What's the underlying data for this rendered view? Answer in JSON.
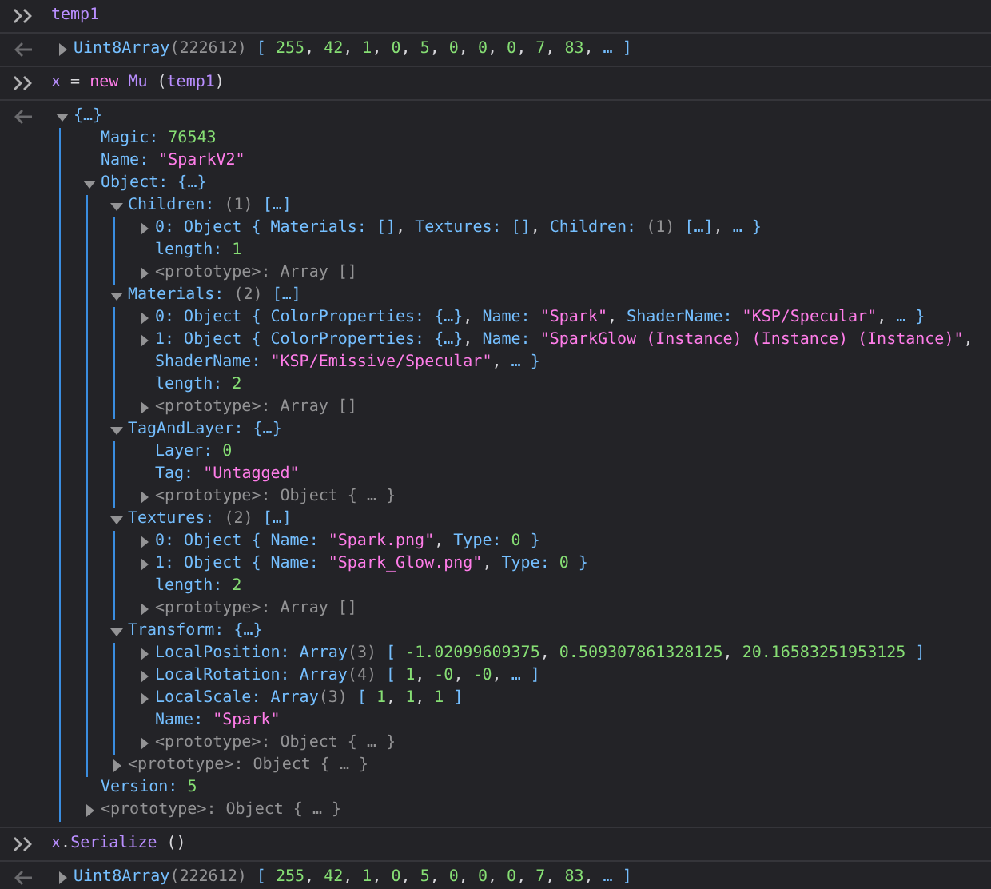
{
  "console": [
    {
      "kind": "input",
      "tokens": [
        {
          "kind": "ident",
          "text": "temp1"
        }
      ]
    },
    {
      "kind": "output",
      "nodes": [
        {
          "kind": "node",
          "expanded": false,
          "tokens": [
            {
              "kind": "key",
              "text": "Uint8Array"
            },
            {
              "kind": "dim",
              "text": "(222612) "
            },
            {
              "kind": "brace",
              "text": "[ "
            },
            {
              "kind": "num",
              "text": "255"
            },
            {
              "kind": "text",
              "text": ", "
            },
            {
              "kind": "num",
              "text": "42"
            },
            {
              "kind": "text",
              "text": ", "
            },
            {
              "kind": "num",
              "text": "1"
            },
            {
              "kind": "text",
              "text": ", "
            },
            {
              "kind": "num",
              "text": "0"
            },
            {
              "kind": "text",
              "text": ", "
            },
            {
              "kind": "num",
              "text": "5"
            },
            {
              "kind": "text",
              "text": ", "
            },
            {
              "kind": "num",
              "text": "0"
            },
            {
              "kind": "text",
              "text": ", "
            },
            {
              "kind": "num",
              "text": "0"
            },
            {
              "kind": "text",
              "text": ", "
            },
            {
              "kind": "num",
              "text": "0"
            },
            {
              "kind": "text",
              "text": ", "
            },
            {
              "kind": "num",
              "text": "7"
            },
            {
              "kind": "text",
              "text": ", "
            },
            {
              "kind": "num",
              "text": "83"
            },
            {
              "kind": "text",
              "text": ", "
            },
            {
              "kind": "brace",
              "text": "… ]"
            }
          ]
        }
      ]
    },
    {
      "kind": "input",
      "tokens": [
        {
          "kind": "ident",
          "text": "x"
        },
        {
          "kind": "op",
          "text": " = "
        },
        {
          "kind": "keyword",
          "text": "new "
        },
        {
          "kind": "ident",
          "text": "Mu"
        },
        {
          "kind": "op",
          "text": " ("
        },
        {
          "kind": "ident",
          "text": "temp1"
        },
        {
          "kind": "op",
          "text": ")"
        }
      ]
    },
    {
      "kind": "output",
      "nodes": [
        {
          "kind": "node",
          "expanded": true,
          "tokens": [
            {
              "kind": "brace",
              "text": "{…}"
            }
          ],
          "children": [
            {
              "kind": "leaf",
              "tokens": [
                {
                  "kind": "key",
                  "text": "Magic: "
                },
                {
                  "kind": "num",
                  "text": "76543"
                }
              ]
            },
            {
              "kind": "leaf",
              "tokens": [
                {
                  "kind": "key",
                  "text": "Name: "
                },
                {
                  "kind": "str",
                  "text": "\"SparkV2\""
                }
              ]
            },
            {
              "kind": "node",
              "expanded": true,
              "tokens": [
                {
                  "kind": "key",
                  "text": "Object: "
                },
                {
                  "kind": "brace",
                  "text": "{…}"
                }
              ],
              "children": [
                {
                  "kind": "node",
                  "expanded": true,
                  "tokens": [
                    {
                      "kind": "key",
                      "text": "Children: "
                    },
                    {
                      "kind": "dim",
                      "text": "(1) "
                    },
                    {
                      "kind": "brace",
                      "text": "[…]"
                    }
                  ],
                  "children": [
                    {
                      "kind": "node",
                      "expanded": false,
                      "tokens": [
                        {
                          "kind": "key",
                          "text": "0: Object { "
                        },
                        {
                          "kind": "key",
                          "text": "Materials: "
                        },
                        {
                          "kind": "brace",
                          "text": "[]"
                        },
                        {
                          "kind": "text",
                          "text": ", "
                        },
                        {
                          "kind": "key",
                          "text": "Textures: "
                        },
                        {
                          "kind": "brace",
                          "text": "[]"
                        },
                        {
                          "kind": "text",
                          "text": ", "
                        },
                        {
                          "kind": "key",
                          "text": "Children: "
                        },
                        {
                          "kind": "dim",
                          "text": "(1) "
                        },
                        {
                          "kind": "brace",
                          "text": "[…]"
                        },
                        {
                          "kind": "text",
                          "text": ", "
                        },
                        {
                          "kind": "brace",
                          "text": "… }"
                        }
                      ]
                    },
                    {
                      "kind": "leaf",
                      "tokens": [
                        {
                          "kind": "key",
                          "text": "length: "
                        },
                        {
                          "kind": "num",
                          "text": "1"
                        }
                      ]
                    },
                    {
                      "kind": "node",
                      "expanded": false,
                      "tokens": [
                        {
                          "kind": "dim",
                          "text": "<prototype>: Array []"
                        }
                      ]
                    }
                  ]
                },
                {
                  "kind": "node",
                  "expanded": true,
                  "tokens": [
                    {
                      "kind": "key",
                      "text": "Materials: "
                    },
                    {
                      "kind": "dim",
                      "text": "(2) "
                    },
                    {
                      "kind": "brace",
                      "text": "[…]"
                    }
                  ],
                  "children": [
                    {
                      "kind": "node",
                      "expanded": false,
                      "tokens": [
                        {
                          "kind": "key",
                          "text": "0: Object { "
                        },
                        {
                          "kind": "key",
                          "text": "ColorProperties: "
                        },
                        {
                          "kind": "brace",
                          "text": "{…}"
                        },
                        {
                          "kind": "text",
                          "text": ", "
                        },
                        {
                          "kind": "key",
                          "text": "Name: "
                        },
                        {
                          "kind": "str",
                          "text": "\"Spark\""
                        },
                        {
                          "kind": "text",
                          "text": ", "
                        },
                        {
                          "kind": "key",
                          "text": "ShaderName: "
                        },
                        {
                          "kind": "str",
                          "text": "\"KSP/Specular\""
                        },
                        {
                          "kind": "text",
                          "text": ", "
                        },
                        {
                          "kind": "brace",
                          "text": "… }"
                        }
                      ]
                    },
                    {
                      "kind": "node",
                      "expanded": false,
                      "tokens": [
                        {
                          "kind": "key",
                          "text": "1: Object { "
                        },
                        {
                          "kind": "key",
                          "text": "ColorProperties: "
                        },
                        {
                          "kind": "brace",
                          "text": "{…}"
                        },
                        {
                          "kind": "text",
                          "text": ", "
                        },
                        {
                          "kind": "key",
                          "text": "Name: "
                        },
                        {
                          "kind": "str",
                          "text": "\"SparkGlow (Instance) (Instance) (Instance)\""
                        },
                        {
                          "kind": "text",
                          "text": ", "
                        },
                        {
                          "kind": "key",
                          "text": "ShaderName: "
                        },
                        {
                          "kind": "str",
                          "text": "\"KSP/Emissive/Specular\""
                        },
                        {
                          "kind": "text",
                          "text": ", "
                        },
                        {
                          "kind": "brace",
                          "text": "… }"
                        }
                      ]
                    },
                    {
                      "kind": "leaf",
                      "tokens": [
                        {
                          "kind": "key",
                          "text": "length: "
                        },
                        {
                          "kind": "num",
                          "text": "2"
                        }
                      ]
                    },
                    {
                      "kind": "node",
                      "expanded": false,
                      "tokens": [
                        {
                          "kind": "dim",
                          "text": "<prototype>: Array []"
                        }
                      ]
                    }
                  ]
                },
                {
                  "kind": "node",
                  "expanded": true,
                  "tokens": [
                    {
                      "kind": "key",
                      "text": "TagAndLayer: "
                    },
                    {
                      "kind": "brace",
                      "text": "{…}"
                    }
                  ],
                  "children": [
                    {
                      "kind": "leaf",
                      "tokens": [
                        {
                          "kind": "key",
                          "text": "Layer: "
                        },
                        {
                          "kind": "num",
                          "text": "0"
                        }
                      ]
                    },
                    {
                      "kind": "leaf",
                      "tokens": [
                        {
                          "kind": "key",
                          "text": "Tag: "
                        },
                        {
                          "kind": "str",
                          "text": "\"Untagged\""
                        }
                      ]
                    },
                    {
                      "kind": "node",
                      "expanded": false,
                      "tokens": [
                        {
                          "kind": "dim",
                          "text": "<prototype>: Object { … }"
                        }
                      ]
                    }
                  ]
                },
                {
                  "kind": "node",
                  "expanded": true,
                  "tokens": [
                    {
                      "kind": "key",
                      "text": "Textures: "
                    },
                    {
                      "kind": "dim",
                      "text": "(2) "
                    },
                    {
                      "kind": "brace",
                      "text": "[…]"
                    }
                  ],
                  "children": [
                    {
                      "kind": "node",
                      "expanded": false,
                      "tokens": [
                        {
                          "kind": "key",
                          "text": "0: Object { "
                        },
                        {
                          "kind": "key",
                          "text": "Name: "
                        },
                        {
                          "kind": "str",
                          "text": "\"Spark.png\""
                        },
                        {
                          "kind": "text",
                          "text": ", "
                        },
                        {
                          "kind": "key",
                          "text": "Type: "
                        },
                        {
                          "kind": "num",
                          "text": "0"
                        },
                        {
                          "kind": "brace",
                          "text": " }"
                        }
                      ]
                    },
                    {
                      "kind": "node",
                      "expanded": false,
                      "tokens": [
                        {
                          "kind": "key",
                          "text": "1: Object { "
                        },
                        {
                          "kind": "key",
                          "text": "Name: "
                        },
                        {
                          "kind": "str",
                          "text": "\"Spark_Glow.png\""
                        },
                        {
                          "kind": "text",
                          "text": ", "
                        },
                        {
                          "kind": "key",
                          "text": "Type: "
                        },
                        {
                          "kind": "num",
                          "text": "0"
                        },
                        {
                          "kind": "brace",
                          "text": " }"
                        }
                      ]
                    },
                    {
                      "kind": "leaf",
                      "tokens": [
                        {
                          "kind": "key",
                          "text": "length: "
                        },
                        {
                          "kind": "num",
                          "text": "2"
                        }
                      ]
                    },
                    {
                      "kind": "node",
                      "expanded": false,
                      "tokens": [
                        {
                          "kind": "dim",
                          "text": "<prototype>: Array []"
                        }
                      ]
                    }
                  ]
                },
                {
                  "kind": "node",
                  "expanded": true,
                  "tokens": [
                    {
                      "kind": "key",
                      "text": "Transform: "
                    },
                    {
                      "kind": "brace",
                      "text": "{…}"
                    }
                  ],
                  "children": [
                    {
                      "kind": "node",
                      "expanded": false,
                      "tokens": [
                        {
                          "kind": "key",
                          "text": "LocalPosition: "
                        },
                        {
                          "kind": "key",
                          "text": "Array"
                        },
                        {
                          "kind": "dim",
                          "text": "(3) "
                        },
                        {
                          "kind": "brace",
                          "text": "[ "
                        },
                        {
                          "kind": "num",
                          "text": "-1.02099609375"
                        },
                        {
                          "kind": "text",
                          "text": ", "
                        },
                        {
                          "kind": "num",
                          "text": "0.509307861328125"
                        },
                        {
                          "kind": "text",
                          "text": ", "
                        },
                        {
                          "kind": "num",
                          "text": "20.16583251953125"
                        },
                        {
                          "kind": "brace",
                          "text": " ]"
                        }
                      ]
                    },
                    {
                      "kind": "node",
                      "expanded": false,
                      "tokens": [
                        {
                          "kind": "key",
                          "text": "LocalRotation: "
                        },
                        {
                          "kind": "key",
                          "text": "Array"
                        },
                        {
                          "kind": "dim",
                          "text": "(4) "
                        },
                        {
                          "kind": "brace",
                          "text": "[ "
                        },
                        {
                          "kind": "num",
                          "text": "1"
                        },
                        {
                          "kind": "text",
                          "text": ", "
                        },
                        {
                          "kind": "num",
                          "text": "-0"
                        },
                        {
                          "kind": "text",
                          "text": ", "
                        },
                        {
                          "kind": "num",
                          "text": "-0"
                        },
                        {
                          "kind": "text",
                          "text": ", "
                        },
                        {
                          "kind": "brace",
                          "text": "… ]"
                        }
                      ]
                    },
                    {
                      "kind": "node",
                      "expanded": false,
                      "tokens": [
                        {
                          "kind": "key",
                          "text": "LocalScale: "
                        },
                        {
                          "kind": "key",
                          "text": "Array"
                        },
                        {
                          "kind": "dim",
                          "text": "(3) "
                        },
                        {
                          "kind": "brace",
                          "text": "[ "
                        },
                        {
                          "kind": "num",
                          "text": "1"
                        },
                        {
                          "kind": "text",
                          "text": ", "
                        },
                        {
                          "kind": "num",
                          "text": "1"
                        },
                        {
                          "kind": "text",
                          "text": ", "
                        },
                        {
                          "kind": "num",
                          "text": "1"
                        },
                        {
                          "kind": "brace",
                          "text": " ]"
                        }
                      ]
                    },
                    {
                      "kind": "leaf",
                      "tokens": [
                        {
                          "kind": "key",
                          "text": "Name: "
                        },
                        {
                          "kind": "str",
                          "text": "\"Spark\""
                        }
                      ]
                    },
                    {
                      "kind": "node",
                      "expanded": false,
                      "tokens": [
                        {
                          "kind": "dim",
                          "text": "<prototype>: Object { … }"
                        }
                      ]
                    }
                  ]
                },
                {
                  "kind": "node",
                  "expanded": false,
                  "tokens": [
                    {
                      "kind": "dim",
                      "text": "<prototype>: Object { … }"
                    }
                  ]
                }
              ]
            },
            {
              "kind": "leaf",
              "tokens": [
                {
                  "kind": "key",
                  "text": "Version: "
                },
                {
                  "kind": "num",
                  "text": "5"
                }
              ]
            },
            {
              "kind": "node",
              "expanded": false,
              "tokens": [
                {
                  "kind": "dim",
                  "text": "<prototype>: Object { … }"
                }
              ]
            }
          ]
        }
      ]
    },
    {
      "kind": "input",
      "tokens": [
        {
          "kind": "ident",
          "text": "x"
        },
        {
          "kind": "op",
          "text": "."
        },
        {
          "kind": "ident",
          "text": "Serialize"
        },
        {
          "kind": "op",
          "text": " ()"
        }
      ]
    },
    {
      "kind": "output",
      "nodes": [
        {
          "kind": "node",
          "expanded": false,
          "tokens": [
            {
              "kind": "key",
              "text": "Uint8Array"
            },
            {
              "kind": "dim",
              "text": "(222612) "
            },
            {
              "kind": "brace",
              "text": "[ "
            },
            {
              "kind": "num",
              "text": "255"
            },
            {
              "kind": "text",
              "text": ", "
            },
            {
              "kind": "num",
              "text": "42"
            },
            {
              "kind": "text",
              "text": ", "
            },
            {
              "kind": "num",
              "text": "1"
            },
            {
              "kind": "text",
              "text": ", "
            },
            {
              "kind": "num",
              "text": "0"
            },
            {
              "kind": "text",
              "text": ", "
            },
            {
              "kind": "num",
              "text": "5"
            },
            {
              "kind": "text",
              "text": ", "
            },
            {
              "kind": "num",
              "text": "0"
            },
            {
              "kind": "text",
              "text": ", "
            },
            {
              "kind": "num",
              "text": "0"
            },
            {
              "kind": "text",
              "text": ", "
            },
            {
              "kind": "num",
              "text": "0"
            },
            {
              "kind": "text",
              "text": ", "
            },
            {
              "kind": "num",
              "text": "7"
            },
            {
              "kind": "text",
              "text": ", "
            },
            {
              "kind": "num",
              "text": "83"
            },
            {
              "kind": "text",
              "text": ", "
            },
            {
              "kind": "brace",
              "text": "… ]"
            }
          ]
        }
      ]
    }
  ]
}
